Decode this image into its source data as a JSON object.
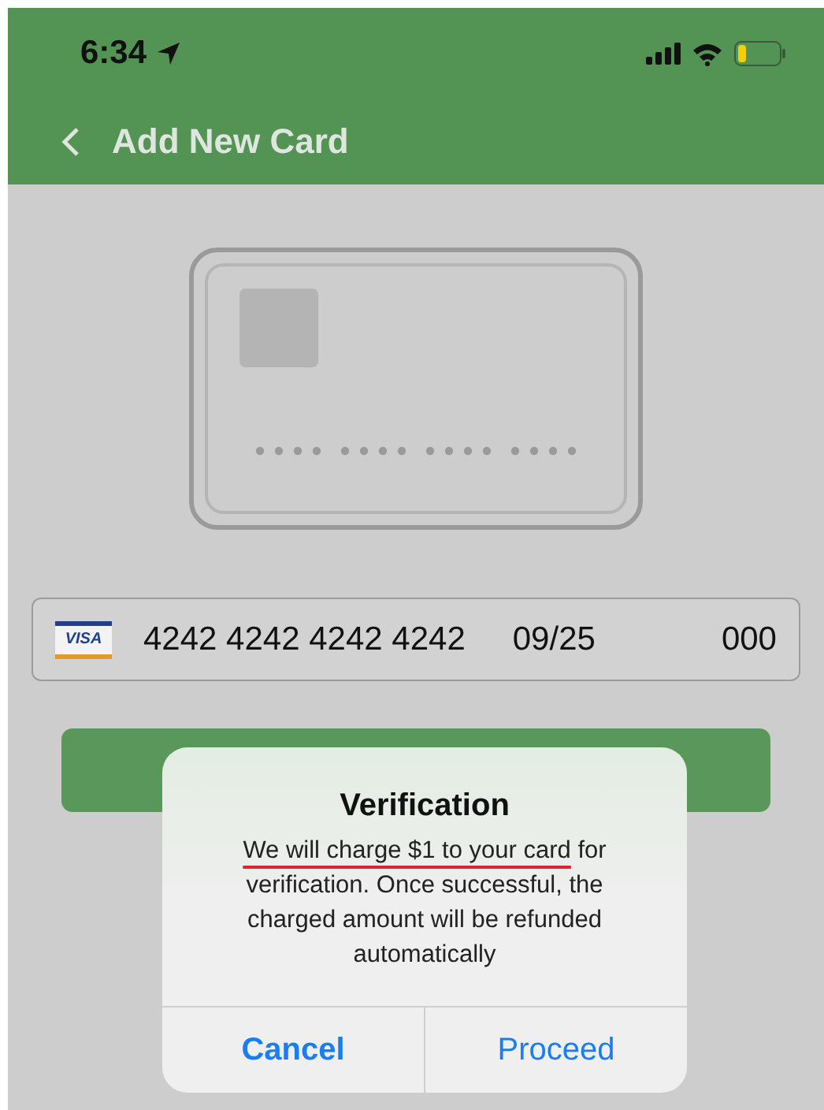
{
  "status_bar": {
    "time": "6:34"
  },
  "nav": {
    "title": "Add New Card"
  },
  "card_input": {
    "brand": "VISA",
    "number": "4242 4242 4242 4242",
    "expiry": "09/25",
    "cvc": "000"
  },
  "dialog": {
    "title": "Verification",
    "message_underlined": "We will charge $1 to your card",
    "message_rest": " for verification. Once successful, the charged amount will be refunded automatically",
    "buttons": [
      {
        "label": "Cancel",
        "kind": "cancel"
      },
      {
        "label": "Proceed",
        "kind": "default"
      }
    ]
  }
}
